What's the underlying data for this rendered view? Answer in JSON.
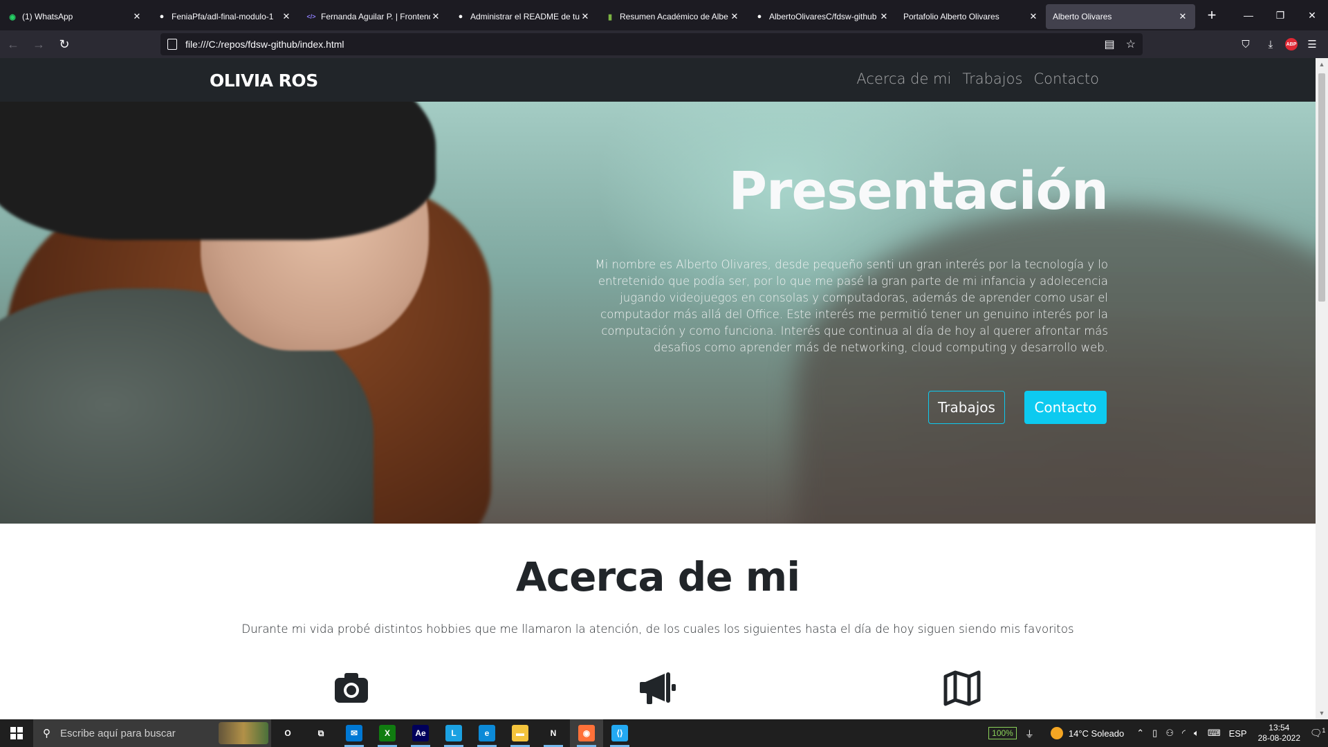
{
  "browser": {
    "tabs": [
      {
        "title": "(1) WhatsApp",
        "icon": "whatsapp-icon",
        "color": "#25d366",
        "active": false
      },
      {
        "title": "FeniaPfa/adl-final-modulo-1",
        "icon": "github-icon",
        "color": "#ffffff",
        "active": false
      },
      {
        "title": "Fernanda Aguilar P. | Frontend",
        "icon": "code-icon",
        "color": "#8b7cf6",
        "active": false
      },
      {
        "title": "Administrar el README de tu",
        "icon": "github-icon",
        "color": "#ffffff",
        "active": false
      },
      {
        "title": "Resumen Académico de Albe",
        "icon": "document-icon",
        "color": "#7cb342",
        "active": false
      },
      {
        "title": "AlbertoOlivaresC/fdsw-github",
        "icon": "github-icon",
        "color": "#ffffff",
        "active": false
      },
      {
        "title": "Portafolio Alberto Olivares",
        "icon": "",
        "color": "",
        "active": false
      },
      {
        "title": "Alberto Olivares",
        "icon": "",
        "color": "",
        "active": true
      }
    ],
    "new_tab": "+",
    "url": "file:///C:/repos/fdsw-github/index.html",
    "abp_label": "ABP"
  },
  "site": {
    "brand": "OLIVIA ROS",
    "nav_links": [
      "Acerca de mi",
      "Trabajos",
      "Contacto"
    ],
    "hero": {
      "title": "Presentación",
      "text": "Mi nombre es Alberto Olivares, desde pequeño senti un gran interés por la tecnología y lo entretenido que podía ser, por lo que me pasé la gran parte de mi infancia y adolecencia jugando videojuegos en consolas y computadoras, además de aprender como usar el computador más allá del Office. Este interés me permitió tener un genuino interés por la computación y como funciona. Interés que continua al día de hoy al querer afrontar más desafios como aprender más de networking, cloud computing y desarrollo web.",
      "btn_works": "Trabajos",
      "btn_contact": "Contacto",
      "accent": "#0dcaf0"
    },
    "about": {
      "title": "Acerca de mi",
      "text": "Durante mi vida probé distintos hobbies que me llamaron la atención, de los cuales los siguientes hasta el día de hoy siguen siendo mis favoritos",
      "hobby_icons": [
        "camera-icon",
        "megaphone-icon",
        "map-icon"
      ]
    }
  },
  "taskbar": {
    "search_placeholder": "Escribe aquí para buscar",
    "apps": [
      {
        "name": "cortana-icon",
        "label": "O"
      },
      {
        "name": "task-view-icon",
        "label": "⧉"
      },
      {
        "name": "mail-icon",
        "label": "✉",
        "color": "#0078d4"
      },
      {
        "name": "xbox-icon",
        "label": "X",
        "color": "#107c10"
      },
      {
        "name": "after-effects-icon",
        "label": "Ae",
        "color": "#00005b"
      },
      {
        "name": "l-app-icon",
        "label": "L",
        "color": "#1ba1e2"
      },
      {
        "name": "edge-icon",
        "label": "e",
        "color": "#0c8ad8"
      },
      {
        "name": "file-explorer-icon",
        "label": "▬",
        "color": "#f3c33c"
      },
      {
        "name": "notion-icon",
        "label": "N",
        "color": "#ffffff"
      },
      {
        "name": "firefox-icon",
        "label": "◉",
        "color": "#ff7139"
      },
      {
        "name": "vscode-icon",
        "label": "⟨⟩",
        "color": "#23a9f2"
      }
    ],
    "battery": "100%",
    "weather": "14°C  Soleado",
    "lang": "ESP",
    "time": "13:54",
    "date": "28-08-2022",
    "notifications": "1"
  }
}
